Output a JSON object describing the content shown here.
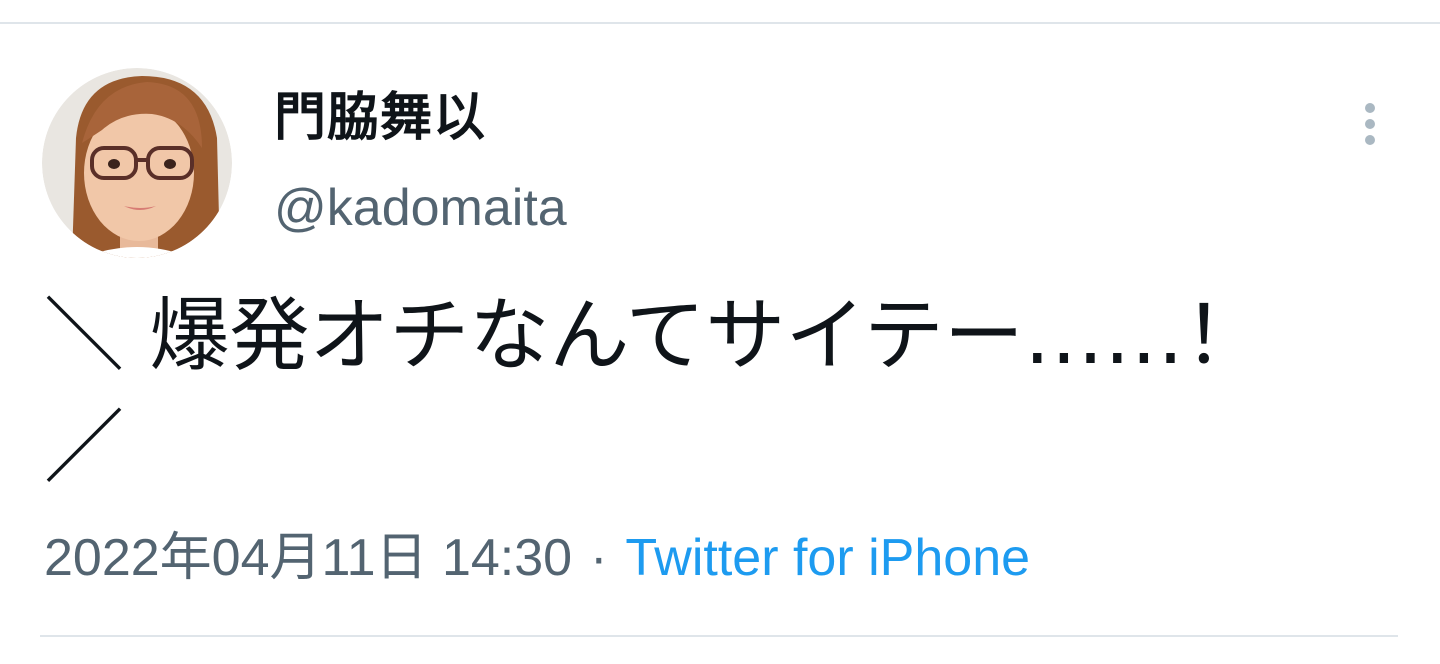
{
  "tweet": {
    "author": {
      "display_name": "門脇舞以",
      "handle": "@kadomaita",
      "avatar_icon": "avatar-photo"
    },
    "more_icon": "more-vertical-icon",
    "text_lines": [
      "＼ 爆発オチなんてサイテー……！",
      "／"
    ],
    "timestamp": "2022年04月11日 14:30",
    "separator": "·",
    "source": "Twitter for iPhone"
  },
  "colors": {
    "text_primary": "#0f1419",
    "text_secondary": "#536471",
    "link": "#1d9bf0",
    "divider": "#dfe5ea",
    "icon_gray": "#aab8c2"
  }
}
